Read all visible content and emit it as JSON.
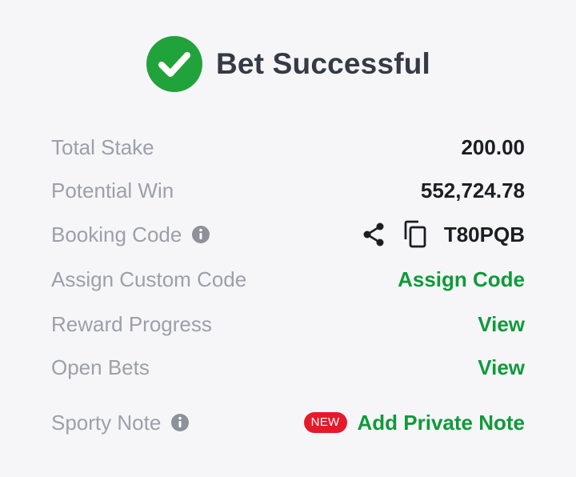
{
  "header": {
    "title": "Bet Successful",
    "icon": "check-circle-icon",
    "icon_color": "#21a33b"
  },
  "rows": [
    {
      "label": "Total Stake",
      "value": "200.00"
    },
    {
      "label": "Potential Win",
      "value": "552,724.78"
    },
    {
      "label": "Booking Code",
      "value": "T80PQB",
      "info_icon": "info-icon",
      "actions": [
        "share-icon",
        "copy-icon"
      ]
    },
    {
      "label": "Assign Custom Code",
      "link": "Assign Code"
    },
    {
      "label": "Reward Progress",
      "link": "View"
    },
    {
      "label": "Open Bets",
      "link": "View"
    },
    {
      "label": "Sporty Note",
      "info_icon": "info-icon",
      "badge": "NEW",
      "link": "Add Private Note"
    }
  ],
  "colors": {
    "link_green": "#0f9a3a",
    "label_gray": "#9ca0aa",
    "value_dark": "#1b1e23",
    "badge_red": "#e41a2b",
    "background": "#f6f6f8"
  }
}
